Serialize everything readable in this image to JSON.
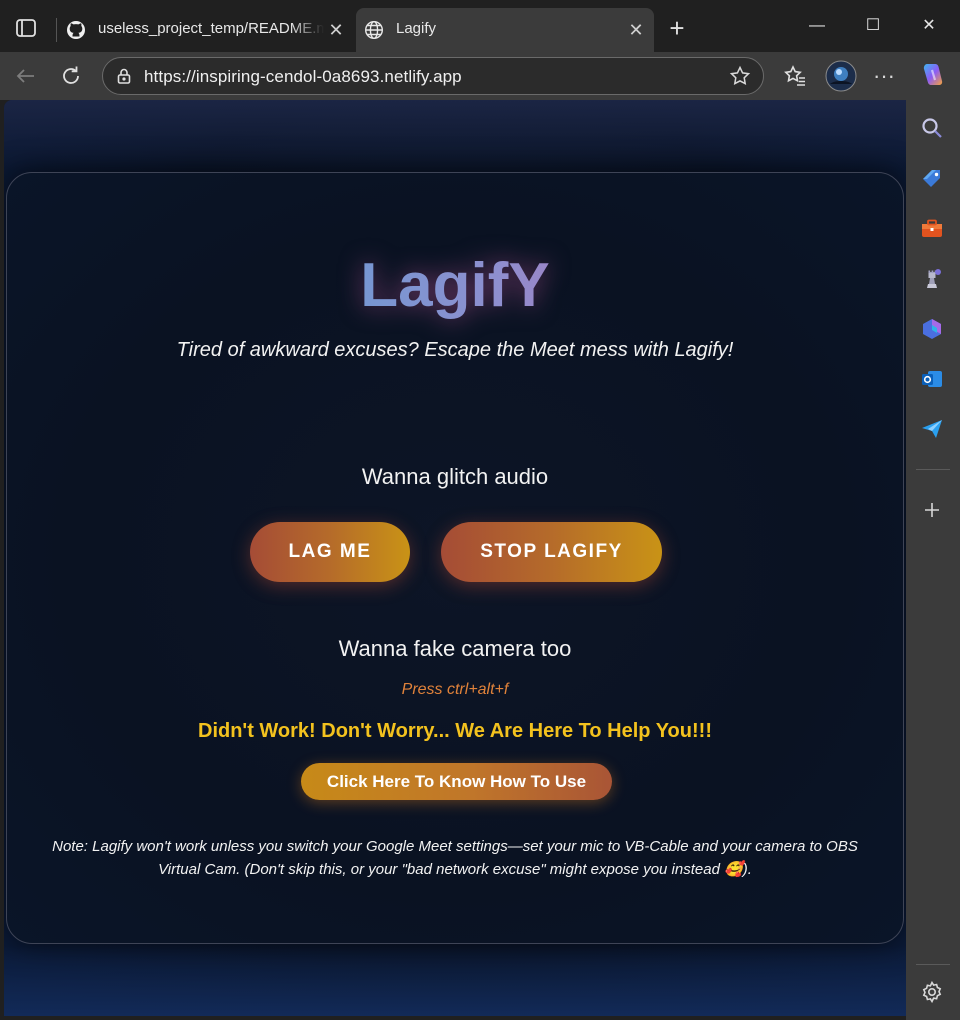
{
  "browser": {
    "tabs": [
      {
        "title": "useless_project_temp/README.md",
        "active": false,
        "favicon": "github-icon"
      },
      {
        "title": "Lagify",
        "active": true,
        "favicon": "globe-icon"
      }
    ],
    "url": "https://inspiring-cendol-0a8693.netlify.app",
    "window_controls": {
      "minimize": "—",
      "maximize": "☐",
      "close": "✕"
    },
    "new_tab": "+",
    "more": "···"
  },
  "page": {
    "logo": "LagifY",
    "subtitle": "Tired of awkward excuses? Escape the Meet mess with Lagify!",
    "audio_heading": "Wanna glitch audio",
    "lag_button": "LAG ME",
    "stop_button": "STOP LAGIFY",
    "camera_heading": "Wanna fake camera too",
    "shortcut_hint": "Press ctrl+alt+f",
    "help_text": "Didn't Work! Don't Worry... We Are Here To Help You!!!",
    "how_button": "Click Here To Know How To Use",
    "note": "Note: Lagify won't work unless you switch your Google Meet settings—set your mic to VB-Cable and your camera to OBS Virtual Cam. (Don't skip this, or your \"bad network excuse\" might expose you instead 🥰)."
  },
  "colors": {
    "accent_gradient_start": "#a54c36",
    "accent_gradient_end": "#c99316",
    "help_yellow": "#f3c21e",
    "hint_orange": "#e0823a",
    "logo_blue": "#49a6d8",
    "logo_pink": "#c35ca8"
  }
}
